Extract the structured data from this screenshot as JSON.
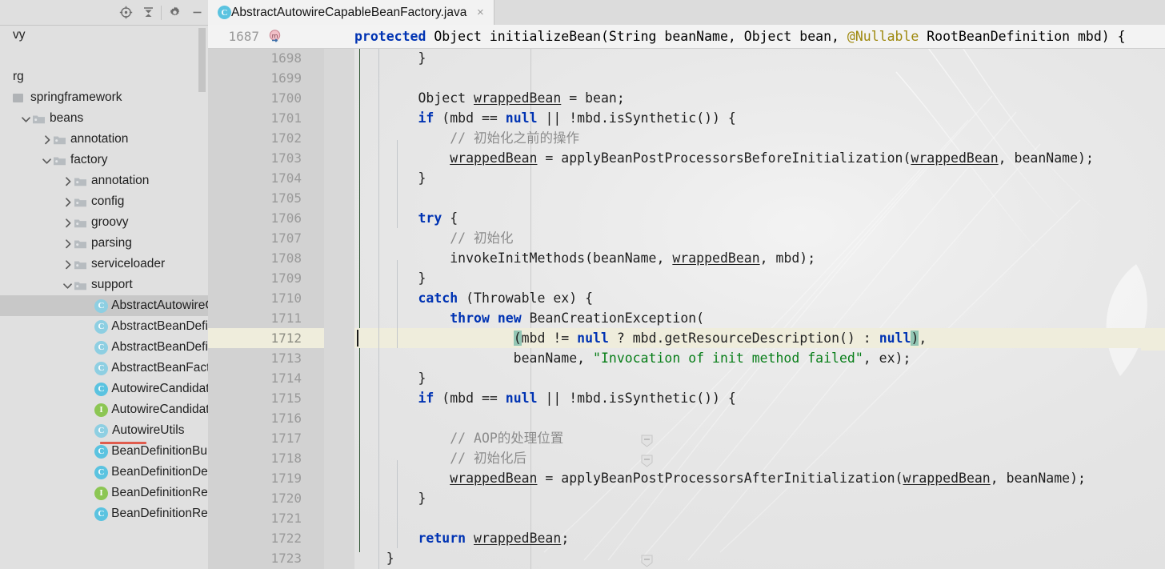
{
  "window": {
    "app": "IntelliJ IDEA",
    "editor_font_px": 16.5
  },
  "project_toolbar": {
    "buttons": [
      {
        "name": "select-opened-file-button",
        "icon": "target-icon",
        "label": "Select Opened File"
      },
      {
        "name": "collapse-all-button",
        "icon": "collapse-all-icon",
        "label": "Collapse All"
      },
      {
        "name": "settings-button",
        "icon": "gear-icon",
        "label": "Settings"
      },
      {
        "name": "hide-button",
        "icon": "minimize-icon",
        "label": "Hide"
      }
    ]
  },
  "project_tree": {
    "items": [
      {
        "label": "vy",
        "depth": 0,
        "twisty": "none",
        "icon": "none",
        "selected": false,
        "error": false
      },
      {
        "label": "",
        "depth": 0,
        "twisty": "none",
        "icon": "none",
        "selected": false,
        "error": false
      },
      {
        "label": "rg",
        "depth": 0,
        "twisty": "none",
        "icon": "none",
        "selected": false,
        "error": false
      },
      {
        "label": "springframework",
        "depth": 0,
        "twisty": "none",
        "icon": "package",
        "selected": false,
        "error": false
      },
      {
        "label": "beans",
        "depth": 1,
        "twisty": "expanded",
        "icon": "folder",
        "selected": false,
        "error": false
      },
      {
        "label": "annotation",
        "depth": 2,
        "twisty": "collapsed",
        "icon": "folder",
        "selected": false,
        "error": false
      },
      {
        "label": "factory",
        "depth": 2,
        "twisty": "expanded",
        "icon": "folder",
        "selected": false,
        "error": false
      },
      {
        "label": "annotation",
        "depth": 3,
        "twisty": "collapsed",
        "icon": "folder",
        "selected": false,
        "error": false
      },
      {
        "label": "config",
        "depth": 3,
        "twisty": "collapsed",
        "icon": "folder",
        "selected": false,
        "error": false
      },
      {
        "label": "groovy",
        "depth": 3,
        "twisty": "collapsed",
        "icon": "folder",
        "selected": false,
        "error": false
      },
      {
        "label": "parsing",
        "depth": 3,
        "twisty": "collapsed",
        "icon": "folder",
        "selected": false,
        "error": false
      },
      {
        "label": "serviceloader",
        "depth": 3,
        "twisty": "collapsed",
        "icon": "folder",
        "selected": false,
        "error": false
      },
      {
        "label": "support",
        "depth": 3,
        "twisty": "expanded",
        "icon": "folder",
        "selected": false,
        "error": false
      },
      {
        "label": "AbstractAutowireCap",
        "depth": 4,
        "twisty": "none",
        "icon": "class-faded",
        "selected": true,
        "error": false
      },
      {
        "label": "AbstractBeanDefiniti",
        "depth": 4,
        "twisty": "none",
        "icon": "class-faded",
        "selected": false,
        "error": false
      },
      {
        "label": "AbstractBeanDefiniti",
        "depth": 4,
        "twisty": "none",
        "icon": "class-faded",
        "selected": false,
        "error": false
      },
      {
        "label": "AbstractBeanFactory",
        "depth": 4,
        "twisty": "none",
        "icon": "class-faded",
        "selected": false,
        "error": false
      },
      {
        "label": "AutowireCandidateQ",
        "depth": 4,
        "twisty": "none",
        "icon": "class",
        "selected": false,
        "error": false
      },
      {
        "label": "AutowireCandidateR",
        "depth": 4,
        "twisty": "none",
        "icon": "interface",
        "selected": false,
        "error": false
      },
      {
        "label": "AutowireUtils",
        "depth": 4,
        "twisty": "none",
        "icon": "class-faded",
        "selected": false,
        "error": false
      },
      {
        "label": "BeanDefinitionBuilde",
        "depth": 4,
        "twisty": "none",
        "icon": "class",
        "selected": false,
        "error": true
      },
      {
        "label": "BeanDefinitionDefaul",
        "depth": 4,
        "twisty": "none",
        "icon": "class",
        "selected": false,
        "error": false
      },
      {
        "label": "BeanDefinitionReade",
        "depth": 4,
        "twisty": "none",
        "icon": "interface",
        "selected": false,
        "error": false
      },
      {
        "label": "BeanDefinitionReade",
        "depth": 4,
        "twisty": "none",
        "icon": "class",
        "selected": false,
        "error": false
      }
    ]
  },
  "tab": {
    "icon": "java-class-icon",
    "title": "AbstractAutowireCapableBeanFactory.java",
    "close_label": "×"
  },
  "sticky_header": {
    "line_number": "1687",
    "gutter_icon": "method-override-icon",
    "tokens": [
      {
        "t": "protected",
        "c": "kw"
      },
      {
        "t": " Object initializeBean(String beanName, Object bean, ",
        "c": ""
      },
      {
        "t": "@Nullable",
        "c": "ann"
      },
      {
        "t": " RootBeanDefinition mbd) {",
        "c": ""
      }
    ]
  },
  "editor": {
    "caret_line": "1712",
    "caret_column_label": "",
    "lines": [
      {
        "n": "1698",
        "indent": 0,
        "current": false,
        "bulb": false,
        "tokens": [
          {
            "t": "        }",
            "c": ""
          }
        ]
      },
      {
        "n": "1699",
        "indent": 0,
        "current": false,
        "bulb": false,
        "tokens": []
      },
      {
        "n": "1700",
        "indent": 0,
        "current": false,
        "bulb": false,
        "tokens": [
          {
            "t": "        Object ",
            "c": ""
          },
          {
            "t": "wrappedBean",
            "c": "u"
          },
          {
            "t": " = bean;",
            "c": ""
          }
        ]
      },
      {
        "n": "1701",
        "indent": 0,
        "current": false,
        "bulb": false,
        "tokens": [
          {
            "t": "        ",
            "c": ""
          },
          {
            "t": "if",
            "c": "kw"
          },
          {
            "t": " (mbd == ",
            "c": ""
          },
          {
            "t": "null",
            "c": "kw"
          },
          {
            "t": " || !mbd.isSynthetic()) {",
            "c": ""
          }
        ]
      },
      {
        "n": "1702",
        "indent": 0,
        "current": false,
        "bulb": false,
        "tokens": [
          {
            "t": "            // 初始化之前的操作",
            "c": "cmt"
          }
        ]
      },
      {
        "n": "1703",
        "indent": 0,
        "current": false,
        "bulb": false,
        "tokens": [
          {
            "t": "            ",
            "c": ""
          },
          {
            "t": "wrappedBean",
            "c": "u"
          },
          {
            "t": " = applyBeanPostProcessorsBeforeInitialization(",
            "c": ""
          },
          {
            "t": "wrappedBean",
            "c": "u"
          },
          {
            "t": ", beanName);",
            "c": ""
          }
        ]
      },
      {
        "n": "1704",
        "indent": 0,
        "current": false,
        "bulb": false,
        "tokens": [
          {
            "t": "        }",
            "c": ""
          }
        ]
      },
      {
        "n": "1705",
        "indent": 0,
        "current": false,
        "bulb": false,
        "tokens": []
      },
      {
        "n": "1706",
        "indent": 0,
        "current": false,
        "bulb": false,
        "tokens": [
          {
            "t": "        ",
            "c": ""
          },
          {
            "t": "try",
            "c": "kw"
          },
          {
            "t": " {",
            "c": ""
          }
        ]
      },
      {
        "n": "1707",
        "indent": 0,
        "current": false,
        "bulb": false,
        "tokens": [
          {
            "t": "            // 初始化",
            "c": "cmt"
          }
        ]
      },
      {
        "n": "1708",
        "indent": 0,
        "current": false,
        "bulb": false,
        "tokens": [
          {
            "t": "            invokeInitMethods(beanName, ",
            "c": ""
          },
          {
            "t": "wrappedBean",
            "c": "u"
          },
          {
            "t": ", mbd);",
            "c": ""
          }
        ]
      },
      {
        "n": "1709",
        "indent": 0,
        "current": false,
        "bulb": false,
        "tokens": [
          {
            "t": "        }",
            "c": ""
          }
        ]
      },
      {
        "n": "1710",
        "indent": 0,
        "current": false,
        "bulb": false,
        "tokens": [
          {
            "t": "        ",
            "c": ""
          },
          {
            "t": "catch",
            "c": "kw"
          },
          {
            "t": " (Throwable ex) {",
            "c": ""
          }
        ]
      },
      {
        "n": "1711",
        "indent": 0,
        "current": false,
        "bulb": false,
        "tokens": [
          {
            "t": "            ",
            "c": ""
          },
          {
            "t": "throw",
            "c": "kw"
          },
          {
            "t": " ",
            "c": ""
          },
          {
            "t": "new",
            "c": "kw"
          },
          {
            "t": " BeanCreationException(",
            "c": ""
          }
        ]
      },
      {
        "n": "1712",
        "indent": 0,
        "current": true,
        "bulb": true,
        "tokens": [
          {
            "t": "                    ",
            "c": ""
          },
          {
            "t": "(",
            "c": "paren-hl"
          },
          {
            "t": "mbd != ",
            "c": ""
          },
          {
            "t": "null",
            "c": "kw"
          },
          {
            "t": " ? mbd.getResourceDescription() : ",
            "c": ""
          },
          {
            "t": "null",
            "c": "kw"
          },
          {
            "t": ")",
            "c": "paren-hl"
          },
          {
            "t": ",",
            "c": ""
          }
        ]
      },
      {
        "n": "1713",
        "indent": 0,
        "current": false,
        "bulb": false,
        "tokens": [
          {
            "t": "                    beanName, ",
            "c": ""
          },
          {
            "t": "\"Invocation of init method failed\"",
            "c": "str"
          },
          {
            "t": ", ex);",
            "c": ""
          }
        ]
      },
      {
        "n": "1714",
        "indent": 0,
        "current": false,
        "bulb": false,
        "tokens": [
          {
            "t": "        }",
            "c": ""
          }
        ]
      },
      {
        "n": "1715",
        "indent": 0,
        "current": false,
        "bulb": false,
        "tokens": [
          {
            "t": "        ",
            "c": ""
          },
          {
            "t": "if",
            "c": "kw"
          },
          {
            "t": " (mbd == ",
            "c": ""
          },
          {
            "t": "null",
            "c": "kw"
          },
          {
            "t": " || !mbd.isSynthetic()) {",
            "c": ""
          }
        ]
      },
      {
        "n": "1716",
        "indent": 0,
        "current": false,
        "bulb": false,
        "tokens": []
      },
      {
        "n": "1717",
        "indent": 0,
        "current": false,
        "bulb": false,
        "tokens": [
          {
            "t": "            // AOP的处理位置",
            "c": "cmt"
          }
        ]
      },
      {
        "n": "1718",
        "indent": 0,
        "current": false,
        "bulb": false,
        "tokens": [
          {
            "t": "            // 初始化后",
            "c": "cmt"
          }
        ]
      },
      {
        "n": "1719",
        "indent": 0,
        "current": false,
        "bulb": false,
        "tokens": [
          {
            "t": "            ",
            "c": ""
          },
          {
            "t": "wrappedBean",
            "c": "u"
          },
          {
            "t": " = applyBeanPostProcessorsAfterInitialization(",
            "c": ""
          },
          {
            "t": "wrappedBean",
            "c": "u"
          },
          {
            "t": ", beanName);",
            "c": ""
          }
        ]
      },
      {
        "n": "1720",
        "indent": 0,
        "current": false,
        "bulb": false,
        "tokens": [
          {
            "t": "        }",
            "c": ""
          }
        ]
      },
      {
        "n": "1721",
        "indent": 0,
        "current": false,
        "bulb": false,
        "tokens": []
      },
      {
        "n": "1722",
        "indent": 0,
        "current": false,
        "bulb": false,
        "tokens": [
          {
            "t": "        ",
            "c": ""
          },
          {
            "t": "return",
            "c": "kw"
          },
          {
            "t": " ",
            "c": ""
          },
          {
            "t": "wrappedBean",
            "c": "u"
          },
          {
            "t": ";",
            "c": ""
          }
        ]
      },
      {
        "n": "1723",
        "indent": 0,
        "current": false,
        "bulb": false,
        "tokens": [
          {
            "t": "    }",
            "c": ""
          }
        ]
      }
    ]
  },
  "colors": {
    "keyword": "#0033b3",
    "string": "#067d17",
    "comment": "#8c8c8c",
    "annotation": "#9e880d",
    "current_line_bg": "#efeddc",
    "selection_bg": "#c8c8c8",
    "gutter_bg": "#d2d2d2",
    "panel_bg": "#e0e0e0",
    "class_icon": "#5bc3e0",
    "interface_icon": "#8cc653",
    "error_mark": "#e05c4e",
    "paren_match": "#93c6b4"
  }
}
